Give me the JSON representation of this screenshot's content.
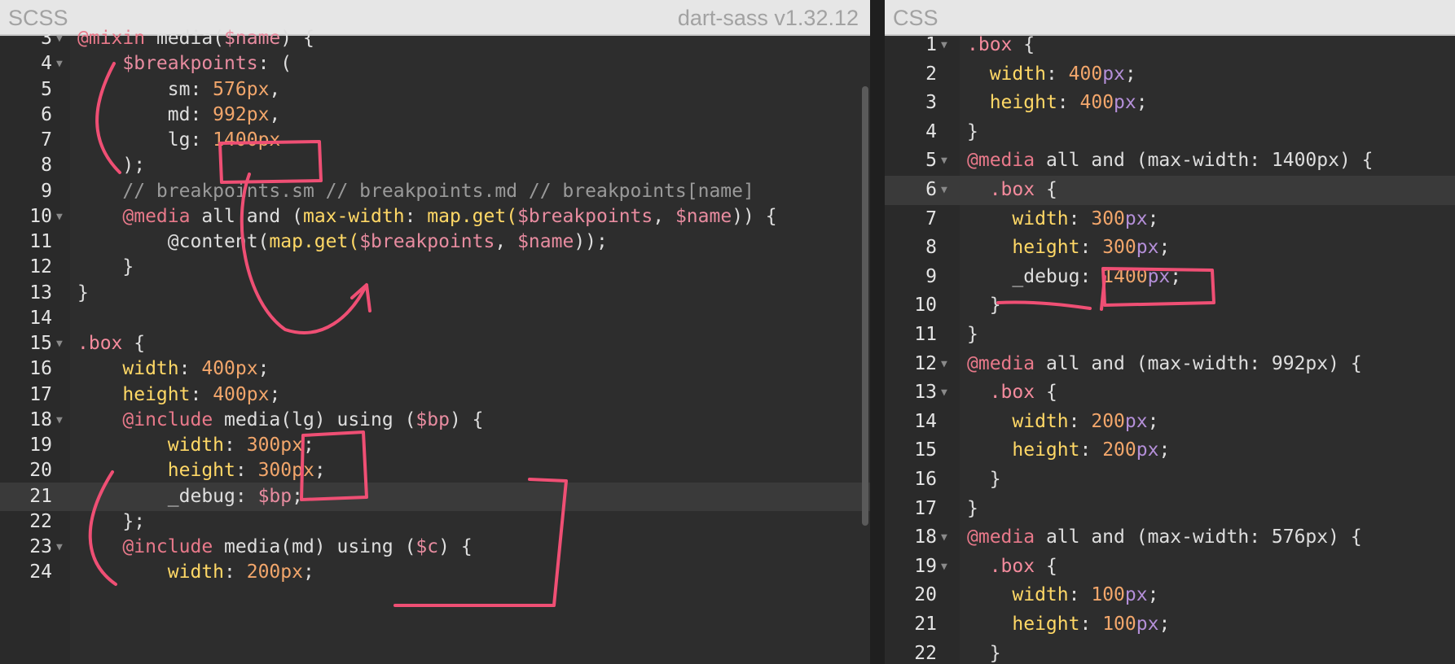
{
  "left_panel": {
    "title": "SCSS",
    "version": "dart-sass v1.32.12",
    "lines": [
      {
        "n": "3",
        "fold": true,
        "active": false,
        "tokens": [
          {
            "t": "@mixin",
            "c": "at"
          },
          {
            "t": " media(",
            "c": ""
          },
          {
            "t": "$name",
            "c": "var"
          },
          {
            "t": ") {",
            "c": ""
          }
        ]
      },
      {
        "n": "4",
        "fold": true,
        "active": false,
        "tokens": [
          {
            "t": "    ",
            "c": ""
          },
          {
            "t": "$breakpoints",
            "c": "var"
          },
          {
            "t": ": (",
            "c": ""
          }
        ]
      },
      {
        "n": "5",
        "fold": false,
        "active": false,
        "tokens": [
          {
            "t": "        sm: ",
            "c": ""
          },
          {
            "t": "576",
            "c": "num"
          },
          {
            "t": "px",
            "c": "num"
          },
          {
            "t": ",",
            "c": ""
          }
        ]
      },
      {
        "n": "6",
        "fold": false,
        "active": false,
        "tokens": [
          {
            "t": "        md: ",
            "c": ""
          },
          {
            "t": "992",
            "c": "num"
          },
          {
            "t": "px",
            "c": "num"
          },
          {
            "t": ",",
            "c": ""
          }
        ]
      },
      {
        "n": "7",
        "fold": false,
        "active": false,
        "tokens": [
          {
            "t": "        lg: ",
            "c": ""
          },
          {
            "t": "1400",
            "c": "num"
          },
          {
            "t": "px",
            "c": "num"
          }
        ]
      },
      {
        "n": "8",
        "fold": false,
        "active": false,
        "tokens": [
          {
            "t": "    );",
            "c": ""
          }
        ]
      },
      {
        "n": "9",
        "fold": false,
        "active": false,
        "tokens": [
          {
            "t": "    // breakpoints.sm // breakpoints.md // breakpoints[name]",
            "c": "cmt"
          }
        ]
      },
      {
        "n": "10",
        "fold": true,
        "active": false,
        "tokens": [
          {
            "t": "    ",
            "c": ""
          },
          {
            "t": "@media",
            "c": "at"
          },
          {
            "t": " all and (",
            "c": ""
          },
          {
            "t": "max-width",
            "c": "fn"
          },
          {
            "t": ": ",
            "c": ""
          },
          {
            "t": "map.get(",
            "c": "fn"
          },
          {
            "t": "$breakpoints",
            "c": "var"
          },
          {
            "t": ", ",
            "c": ""
          },
          {
            "t": "$name",
            "c": "var"
          },
          {
            "t": ")) {",
            "c": ""
          }
        ]
      },
      {
        "n": "11",
        "fold": false,
        "active": false,
        "tokens": [
          {
            "t": "        @content(",
            "c": ""
          },
          {
            "t": "map.get(",
            "c": "fn"
          },
          {
            "t": "$breakpoints",
            "c": "var"
          },
          {
            "t": ", ",
            "c": ""
          },
          {
            "t": "$name",
            "c": "var"
          },
          {
            "t": "));",
            "c": ""
          }
        ]
      },
      {
        "n": "12",
        "fold": false,
        "active": false,
        "tokens": [
          {
            "t": "    }",
            "c": ""
          }
        ]
      },
      {
        "n": "13",
        "fold": false,
        "active": false,
        "tokens": [
          {
            "t": "}",
            "c": ""
          }
        ]
      },
      {
        "n": "14",
        "fold": false,
        "active": false,
        "tokens": []
      },
      {
        "n": "15",
        "fold": true,
        "active": false,
        "tokens": [
          {
            "t": ".box",
            "c": "sel"
          },
          {
            "t": " {",
            "c": ""
          }
        ]
      },
      {
        "n": "16",
        "fold": false,
        "active": false,
        "tokens": [
          {
            "t": "    ",
            "c": ""
          },
          {
            "t": "width",
            "c": "fn"
          },
          {
            "t": ": ",
            "c": ""
          },
          {
            "t": "400",
            "c": "num"
          },
          {
            "t": "px",
            "c": "num"
          },
          {
            "t": ";",
            "c": ""
          }
        ]
      },
      {
        "n": "17",
        "fold": false,
        "active": false,
        "tokens": [
          {
            "t": "    ",
            "c": ""
          },
          {
            "t": "height",
            "c": "fn"
          },
          {
            "t": ": ",
            "c": ""
          },
          {
            "t": "400",
            "c": "num"
          },
          {
            "t": "px",
            "c": "num"
          },
          {
            "t": ";",
            "c": ""
          }
        ]
      },
      {
        "n": "18",
        "fold": true,
        "active": false,
        "tokens": [
          {
            "t": "    ",
            "c": ""
          },
          {
            "t": "@include",
            "c": "at"
          },
          {
            "t": " media(lg) using (",
            "c": ""
          },
          {
            "t": "$bp",
            "c": "var"
          },
          {
            "t": ") {",
            "c": ""
          }
        ]
      },
      {
        "n": "19",
        "fold": false,
        "active": false,
        "tokens": [
          {
            "t": "        ",
            "c": ""
          },
          {
            "t": "width",
            "c": "fn"
          },
          {
            "t": ": ",
            "c": ""
          },
          {
            "t": "300",
            "c": "num"
          },
          {
            "t": "px",
            "c": "num"
          },
          {
            "t": ";",
            "c": ""
          }
        ]
      },
      {
        "n": "20",
        "fold": false,
        "active": false,
        "tokens": [
          {
            "t": "        ",
            "c": ""
          },
          {
            "t": "height",
            "c": "fn"
          },
          {
            "t": ": ",
            "c": ""
          },
          {
            "t": "300",
            "c": "num"
          },
          {
            "t": "px",
            "c": "num"
          },
          {
            "t": ";",
            "c": ""
          }
        ]
      },
      {
        "n": "21",
        "fold": false,
        "active": true,
        "tokens": [
          {
            "t": "        _debug: ",
            "c": ""
          },
          {
            "t": "$bp",
            "c": "var"
          },
          {
            "t": ";",
            "c": ""
          }
        ]
      },
      {
        "n": "22",
        "fold": false,
        "active": false,
        "tokens": [
          {
            "t": "    };",
            "c": ""
          }
        ]
      },
      {
        "n": "23",
        "fold": true,
        "active": false,
        "tokens": [
          {
            "t": "    ",
            "c": ""
          },
          {
            "t": "@include",
            "c": "at"
          },
          {
            "t": " media(md) using (",
            "c": ""
          },
          {
            "t": "$c",
            "c": "var"
          },
          {
            "t": ") {",
            "c": ""
          }
        ]
      },
      {
        "n": "24",
        "fold": false,
        "active": false,
        "tokens": [
          {
            "t": "        ",
            "c": ""
          },
          {
            "t": "width",
            "c": "fn"
          },
          {
            "t": ": ",
            "c": ""
          },
          {
            "t": "200",
            "c": "num"
          },
          {
            "t": "px",
            "c": "num"
          },
          {
            "t": ";",
            "c": ""
          }
        ]
      }
    ]
  },
  "right_panel": {
    "title": "CSS",
    "lines": [
      {
        "n": "1",
        "fold": true,
        "active": false,
        "tokens": [
          {
            "t": ".box",
            "c": "sel"
          },
          {
            "t": " {",
            "c": ""
          }
        ]
      },
      {
        "n": "2",
        "fold": false,
        "active": false,
        "tokens": [
          {
            "t": "  ",
            "c": ""
          },
          {
            "t": "width",
            "c": "fn"
          },
          {
            "t": ": ",
            "c": ""
          },
          {
            "t": "400",
            "c": "num"
          },
          {
            "t": "px",
            "c": "unit"
          },
          {
            "t": ";",
            "c": ""
          }
        ]
      },
      {
        "n": "3",
        "fold": false,
        "active": false,
        "tokens": [
          {
            "t": "  ",
            "c": ""
          },
          {
            "t": "height",
            "c": "fn"
          },
          {
            "t": ": ",
            "c": ""
          },
          {
            "t": "400",
            "c": "num"
          },
          {
            "t": "px",
            "c": "unit"
          },
          {
            "t": ";",
            "c": ""
          }
        ]
      },
      {
        "n": "4",
        "fold": false,
        "active": false,
        "tokens": [
          {
            "t": "}",
            "c": ""
          }
        ]
      },
      {
        "n": "5",
        "fold": true,
        "active": false,
        "tokens": [
          {
            "t": "@media",
            "c": "at"
          },
          {
            "t": " all and (max-width: 1400px) {",
            "c": ""
          }
        ]
      },
      {
        "n": "6",
        "fold": true,
        "active": true,
        "tokens": [
          {
            "t": "  ",
            "c": ""
          },
          {
            "t": ".box",
            "c": "sel"
          },
          {
            "t": " {",
            "c": ""
          }
        ]
      },
      {
        "n": "7",
        "fold": false,
        "active": false,
        "tokens": [
          {
            "t": "    ",
            "c": ""
          },
          {
            "t": "width",
            "c": "fn"
          },
          {
            "t": ": ",
            "c": ""
          },
          {
            "t": "300",
            "c": "num"
          },
          {
            "t": "px",
            "c": "unit"
          },
          {
            "t": ";",
            "c": ""
          }
        ]
      },
      {
        "n": "8",
        "fold": false,
        "active": false,
        "tokens": [
          {
            "t": "    ",
            "c": ""
          },
          {
            "t": "height",
            "c": "fn"
          },
          {
            "t": ": ",
            "c": ""
          },
          {
            "t": "300",
            "c": "num"
          },
          {
            "t": "px",
            "c": "unit"
          },
          {
            "t": ";",
            "c": ""
          }
        ]
      },
      {
        "n": "9",
        "fold": false,
        "active": false,
        "tokens": [
          {
            "t": "    _debug: ",
            "c": ""
          },
          {
            "t": "1400",
            "c": "num"
          },
          {
            "t": "px",
            "c": "unit"
          },
          {
            "t": ";",
            "c": ""
          }
        ]
      },
      {
        "n": "10",
        "fold": false,
        "active": false,
        "tokens": [
          {
            "t": "  }",
            "c": ""
          }
        ]
      },
      {
        "n": "11",
        "fold": false,
        "active": false,
        "tokens": [
          {
            "t": "}",
            "c": ""
          }
        ]
      },
      {
        "n": "12",
        "fold": true,
        "active": false,
        "tokens": [
          {
            "t": "@media",
            "c": "at"
          },
          {
            "t": " all and (max-width: 992px) {",
            "c": ""
          }
        ]
      },
      {
        "n": "13",
        "fold": true,
        "active": false,
        "tokens": [
          {
            "t": "  ",
            "c": ""
          },
          {
            "t": ".box",
            "c": "sel"
          },
          {
            "t": " {",
            "c": ""
          }
        ]
      },
      {
        "n": "14",
        "fold": false,
        "active": false,
        "tokens": [
          {
            "t": "    ",
            "c": ""
          },
          {
            "t": "width",
            "c": "fn"
          },
          {
            "t": ": ",
            "c": ""
          },
          {
            "t": "200",
            "c": "num"
          },
          {
            "t": "px",
            "c": "unit"
          },
          {
            "t": ";",
            "c": ""
          }
        ]
      },
      {
        "n": "15",
        "fold": false,
        "active": false,
        "tokens": [
          {
            "t": "    ",
            "c": ""
          },
          {
            "t": "height",
            "c": "fn"
          },
          {
            "t": ": ",
            "c": ""
          },
          {
            "t": "200",
            "c": "num"
          },
          {
            "t": "px",
            "c": "unit"
          },
          {
            "t": ";",
            "c": ""
          }
        ]
      },
      {
        "n": "16",
        "fold": false,
        "active": false,
        "tokens": [
          {
            "t": "  }",
            "c": ""
          }
        ]
      },
      {
        "n": "17",
        "fold": false,
        "active": false,
        "tokens": [
          {
            "t": "}",
            "c": ""
          }
        ]
      },
      {
        "n": "18",
        "fold": true,
        "active": false,
        "tokens": [
          {
            "t": "@media",
            "c": "at"
          },
          {
            "t": " all and (max-width: 576px) {",
            "c": ""
          }
        ]
      },
      {
        "n": "19",
        "fold": true,
        "active": false,
        "tokens": [
          {
            "t": "  ",
            "c": ""
          },
          {
            "t": ".box",
            "c": "sel"
          },
          {
            "t": " {",
            "c": ""
          }
        ]
      },
      {
        "n": "20",
        "fold": false,
        "active": false,
        "tokens": [
          {
            "t": "    ",
            "c": ""
          },
          {
            "t": "width",
            "c": "fn"
          },
          {
            "t": ": ",
            "c": ""
          },
          {
            "t": "100",
            "c": "num"
          },
          {
            "t": "px",
            "c": "unit"
          },
          {
            "t": ";",
            "c": ""
          }
        ]
      },
      {
        "n": "21",
        "fold": false,
        "active": false,
        "tokens": [
          {
            "t": "    ",
            "c": ""
          },
          {
            "t": "height",
            "c": "fn"
          },
          {
            "t": ": ",
            "c": ""
          },
          {
            "t": "100",
            "c": "num"
          },
          {
            "t": "px",
            "c": "unit"
          },
          {
            "t": ";",
            "c": ""
          }
        ]
      },
      {
        "n": "22",
        "fold": false,
        "active": false,
        "tokens": [
          {
            "t": "  }",
            "c": ""
          }
        ]
      }
    ]
  },
  "icons": {
    "fold": "fold-arrow-icon"
  },
  "colors": {
    "editor_bg": "#2d2d2d",
    "header_bg": "#e6e6e6",
    "annotation": "#ef4f74",
    "active_line": "#3a3a3a"
  }
}
